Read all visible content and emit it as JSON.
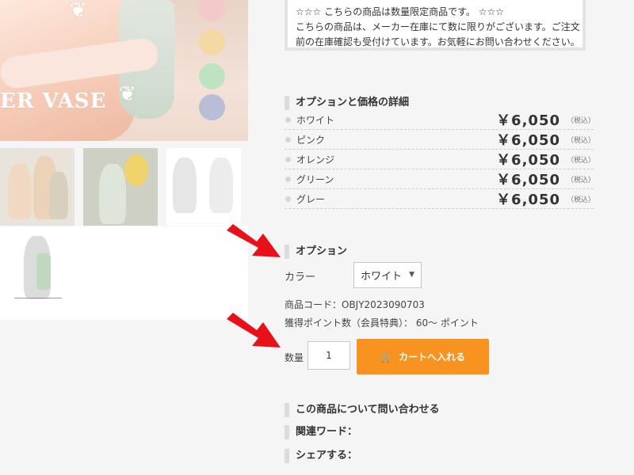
{
  "gallery": {
    "banner_text": "ER VASE",
    "swatch_colors": [
      "#f4c9c9",
      "#f5d9a4",
      "#bfe3c2",
      "#b9bdd6"
    ]
  },
  "notice": {
    "line1": "☆☆☆ こちらの商品は数量限定商品です。 ☆☆☆",
    "line2": "こちらの商品は、メーカー在庫にて数に限りがございます。ご注文",
    "line3": "前の在庫確認も受付けています。お気軽にお問い合わせください。"
  },
  "options_price": {
    "heading": "オプションと価格の詳細",
    "rows": [
      {
        "name": "ホワイト",
        "price": "￥6,050",
        "tax": "（税込）"
      },
      {
        "name": "ピンク",
        "price": "￥6,050",
        "tax": "（税込）"
      },
      {
        "name": "オレンジ",
        "price": "￥6,050",
        "tax": "（税込）"
      },
      {
        "name": "グリーン",
        "price": "￥6,050",
        "tax": "（税込）"
      },
      {
        "name": "グレー",
        "price": "￥6,050",
        "tax": "（税込）"
      }
    ]
  },
  "option": {
    "heading": "オプション",
    "color_label": "カラー",
    "color_selected": "ホワイト"
  },
  "product": {
    "code_line": "商品コード：OBJY2023090703",
    "points_line": "獲得ポイント数（会員特典）： 60～ ポイント"
  },
  "purchase": {
    "qty_label": "数量",
    "qty_value": "1",
    "cart_button": "カートへ入れる"
  },
  "links": {
    "inquiry": "この商品について問い合わせる",
    "related": "関連ワード：",
    "share": "シェアする："
  },
  "colors": {
    "accent": "#f7931e",
    "arrow": "#e8111a"
  }
}
